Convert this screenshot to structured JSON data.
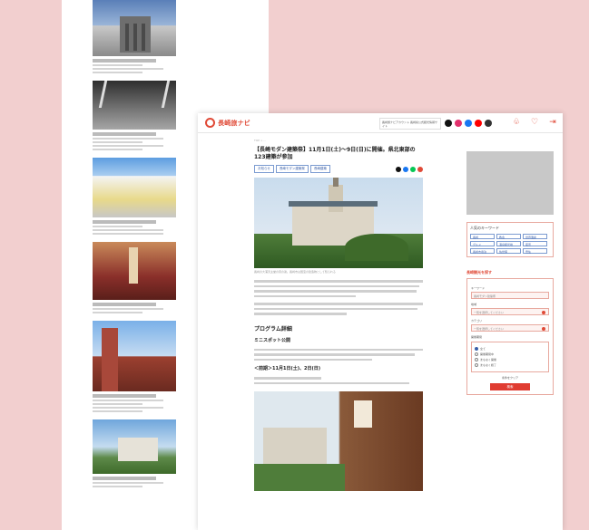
{
  "site": {
    "logo_text": "長崎旅ナビ",
    "header_box_text": "長崎旅ナビアカウント 長崎県公式観光情報サイト",
    "colors": {
      "accent": "#e04a37",
      "tag": "#3a5fa8",
      "background": "#f2cfcf"
    }
  },
  "header_icons": [
    "bell-icon",
    "bookmark-icon",
    "login-icon"
  ],
  "article": {
    "breadcrumb": "TOP > ...",
    "title": "【長崎モダン建築祭】11月1日(土)〜9日(日)に開催。県北東部の123建築が参加",
    "tags": [
      "お知らせ",
      "長崎モダン建築祭",
      "長崎建築"
    ],
    "hero_caption": "長崎の大浦天主堂の昔の姿。長崎市は国宝の建造物として知られる",
    "section_title": "プログラム詳細",
    "sub_title": "ミニスポット公開",
    "sub_title2": "＜前期＞11月1日(土)、2日(日)"
  },
  "sidebar": {
    "keywords_title": "人気のキーワード",
    "keywords": [
      "長崎",
      "教会",
      "世界遺産",
      "グルメ",
      "温泉観光地",
      "夜景",
      "長崎市宿泊",
      "佐世保",
      "雲仙"
    ],
    "search_title": "長崎観光を探す",
    "search_label_1": "キーワード",
    "search_value_1": "長崎モダン建築祭",
    "search_label_2": "地域",
    "search_value_2": "一覧を選択してください",
    "search_label_3": "カテゴリ",
    "search_value_3": "一覧を選択してください",
    "radio_label": "開催期間",
    "radio_options": [
      "全て",
      "開催期間中",
      "まもなく開催",
      "まもなく終了"
    ],
    "reset_label": "条件をクリア",
    "submit_label": "検索"
  }
}
